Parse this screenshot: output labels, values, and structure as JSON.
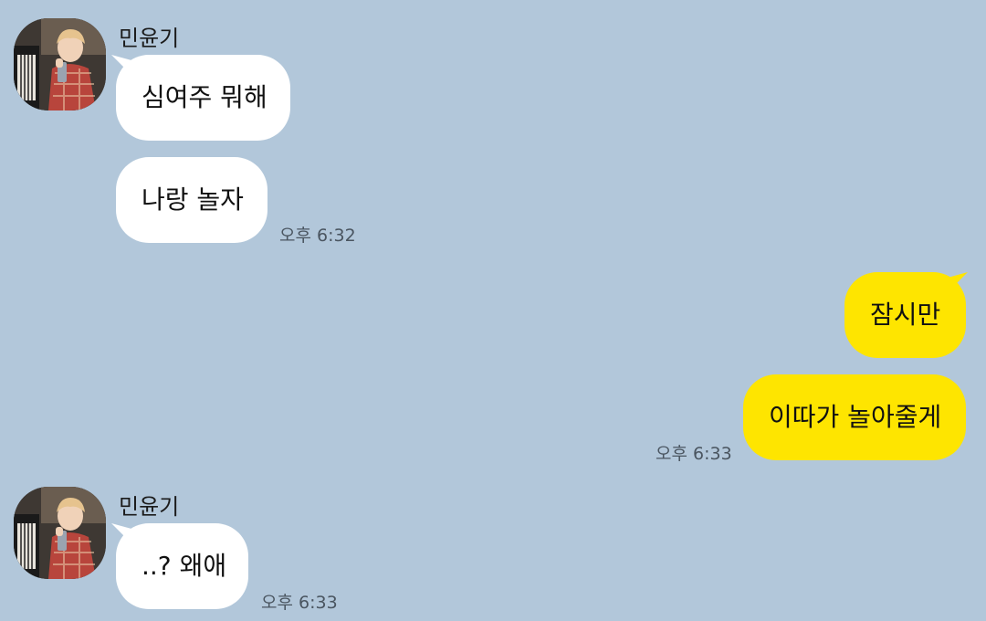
{
  "colors": {
    "background": "#b2c7da",
    "incoming_bubble": "#ffffff",
    "outgoing_bubble": "#fee500"
  },
  "groups": [
    {
      "sender": "민윤기",
      "avatar_icon": "profile-photo-icon",
      "messages": [
        "심여주 뭐해",
        "나랑 놀자"
      ],
      "time": "오후 6:32"
    },
    {
      "sender": "me",
      "messages": [
        "잠시만",
        "이따가 놀아줄게"
      ],
      "time": "오후 6:33"
    },
    {
      "sender": "민윤기",
      "avatar_icon": "profile-photo-icon",
      "messages": [
        "..? 왜애"
      ],
      "time": "오후 6:33"
    }
  ]
}
